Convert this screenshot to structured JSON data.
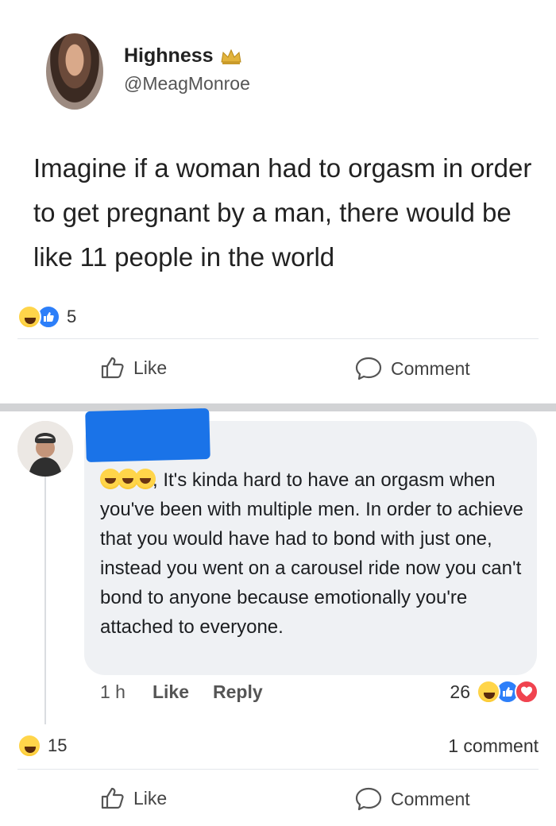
{
  "post": {
    "author_name": "Highness",
    "handle": "@MeagMonroe",
    "text": "Imagine if a woman had to orgasm in order to get pregnant by a man, there would be like 11 people in the world",
    "reaction_count": "5",
    "like_label": "Like",
    "comment_label": "Comment"
  },
  "comment": {
    "text": ", It's kinda hard to have an orgasm when you've been with multiple men. In order to achieve that you would have had to bond with just one, instead you went on  a  carousel ride  now you can't bond to anyone because emotionally you're attached to everyone.",
    "time": "1 h",
    "like_label": "Like",
    "reply_label": "Reply",
    "reaction_count": "26"
  },
  "summary": {
    "reaction_count": "15",
    "comment_count": "1 comment",
    "like_label": "Like",
    "comment_label": "Comment"
  },
  "colors": {
    "like_blue": "#2d7ff9",
    "love_red": "#f0434f",
    "haha_yellow": "#ffd54a",
    "redaction_blue": "#1a73e8"
  }
}
